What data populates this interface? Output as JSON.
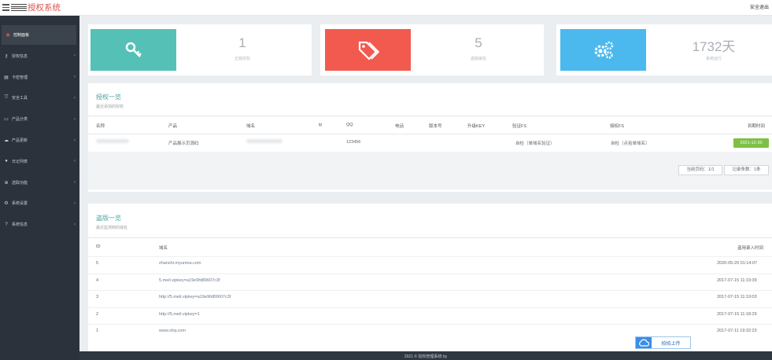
{
  "header": {
    "brand": "授权系统",
    "logout": "安全退出"
  },
  "sidebar": {
    "items": [
      {
        "label": "控制面板",
        "icon": "dashboard-icon",
        "glyph": "◉",
        "active": true
      },
      {
        "label": "授权信息",
        "icon": "key-icon",
        "glyph": "⚷"
      },
      {
        "label": "卡密管理",
        "icon": "list-icon",
        "glyph": "▤"
      },
      {
        "label": "安全工具",
        "icon": "shield-icon",
        "glyph": "⛉"
      },
      {
        "label": "产品分类",
        "icon": "folder-icon",
        "glyph": "▭"
      },
      {
        "label": "产品更新",
        "icon": "cloud-icon",
        "glyph": "☁"
      },
      {
        "label": "日记列表",
        "icon": "info-icon",
        "glyph": "●"
      },
      {
        "label": "选取功能",
        "icon": "globe-icon",
        "glyph": "⊕"
      },
      {
        "label": "系统设置",
        "icon": "gears-icon",
        "glyph": "⚙"
      },
      {
        "label": "系统信息",
        "icon": "question-icon",
        "glyph": "?"
      }
    ],
    "arrow": "‹"
  },
  "stats": [
    {
      "value": "1",
      "label": "正版授权",
      "color": "#55c1b6",
      "icon": "key-icon"
    },
    {
      "value": "5",
      "label": "盗版域名",
      "color": "#f25a4f",
      "icon": "tags-icon"
    },
    {
      "value": "1732天",
      "label": "系统运行",
      "color": "#4cb9ee",
      "icon": "gears-icon"
    }
  ],
  "auth_section": {
    "title": "授权一览",
    "subtitle": "最近添加的授权",
    "columns": [
      "名称",
      "产品",
      "域名",
      "ip",
      "QQ",
      "电话",
      "版本号",
      "升级KEY",
      "验证FS",
      "授权FS",
      "到期时间"
    ],
    "row": {
      "product": "产品展示页源码",
      "qq": "123456",
      "verify_fs": "自检（单域名验证）",
      "auth_fs": "自检（点拾单域名）",
      "expiry": "2021-12-20"
    },
    "pager": {
      "page": "当前页码：1/1",
      "total": "记录条数：1条"
    }
  },
  "piracy_section": {
    "title": "盗版一览",
    "subtitle": "最近监测到的域名",
    "columns": [
      "ID",
      "域名",
      "盗用录入时间"
    ],
    "rows": [
      {
        "id": "5",
        "domain": "zhanshi.myunma.com",
        "time": "2020-05-20 01:14:07"
      },
      {
        "id": "4",
        "domain": "5.meil.vipkey=a19e9fd89607c3f",
        "time": "2017-07-15 11:19:39"
      },
      {
        "id": "3",
        "domain": "http://5.meil.vipkey=a19e9fd89607c3f",
        "time": "2017-07-15 11:19:03"
      },
      {
        "id": "2",
        "domain": "http://5.meil.vipkey=1",
        "time": "2017-07-15 11:18:29"
      },
      {
        "id": "1",
        "domain": "www.shq.com",
        "time": "2017-07-11 19:32:23"
      }
    ]
  },
  "upload_button": "拍拍上传",
  "footer": "2021 © 授权管理系统 by"
}
